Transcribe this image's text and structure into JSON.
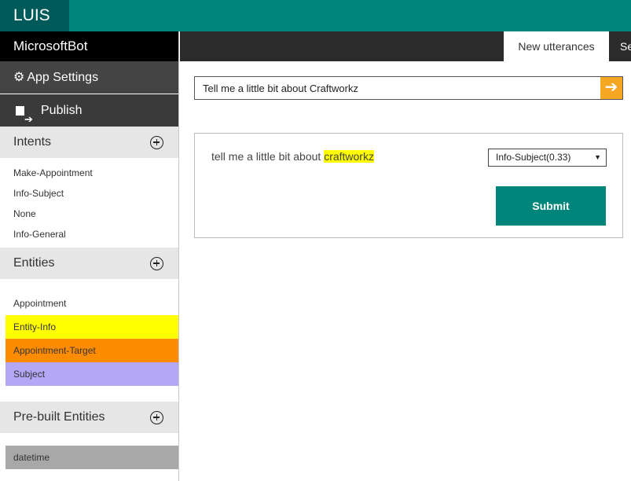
{
  "header": {
    "app_title": "LUIS"
  },
  "sidebar": {
    "app_name": "MicrosoftBot",
    "app_settings_label": "App Settings",
    "publish_label": "Publish",
    "intents": {
      "title": "Intents",
      "items": [
        "Make-Appointment",
        "Info-Subject",
        "None",
        "Info-General"
      ]
    },
    "entities": {
      "title": "Entities",
      "items": [
        "Appointment",
        "Entity-Info",
        "Appointment-Target",
        "Subject"
      ],
      "colors": {
        "Entity-Info": "#ffff00",
        "Appointment-Target": "#ff8c00",
        "Subject": "#b4a7f5"
      }
    },
    "prebuilt": {
      "title": "Pre-built Entities",
      "items": [
        "datetime"
      ]
    }
  },
  "tabs": {
    "active_label": "New utterances",
    "next_label": "Se"
  },
  "search": {
    "value": "Tell me a little bit about Craftworkz",
    "go_icon": "arrow-right-icon"
  },
  "utterance": {
    "text_before": "tell me a little bit about ",
    "highlighted": "craftworkz",
    "intent_selected": "Info-Subject(0.33)",
    "submit_label": "Submit"
  },
  "colors": {
    "accent": "#00857a",
    "logo_bg": "#005a59",
    "go_button": "#f5a623"
  }
}
